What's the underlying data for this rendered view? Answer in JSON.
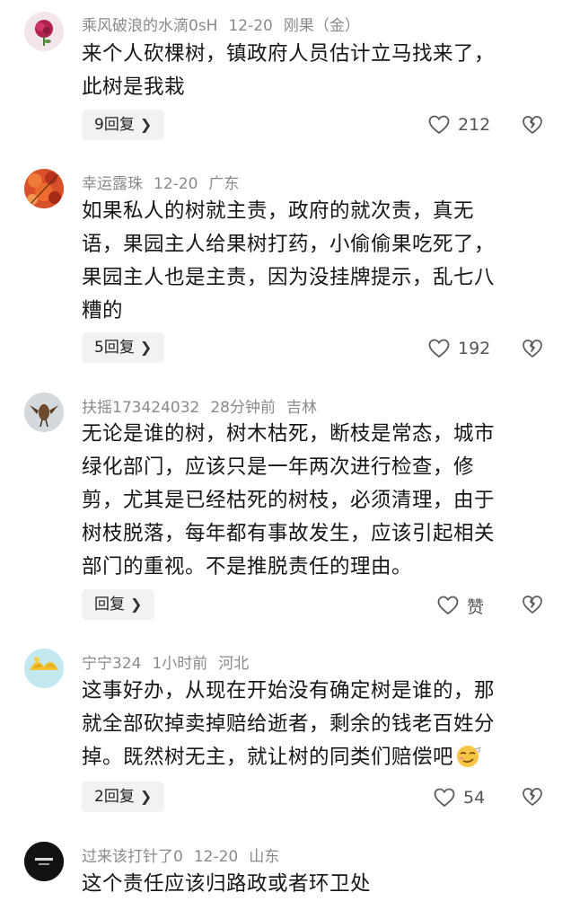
{
  "comments": [
    {
      "username": "乘风破浪的水滴0sH",
      "time": "12-20",
      "location": "刚果（金）",
      "lines": [
        "来个人砍棵树，镇政府人员估计立马找来了，",
        "此树是我栽"
      ],
      "reply_label": "9回复",
      "like_count": "212"
    },
    {
      "username": "幸运露珠",
      "time": "12-20",
      "location": "广东",
      "lines": [
        "如果私人的树就主责，政府的就次责，真无",
        "语，果园主人给果树打药，小偷偷果吃死了，",
        "果园主人也是主责，因为没挂牌提示，乱七八",
        "糟的"
      ],
      "reply_label": "5回复",
      "like_count": "192"
    },
    {
      "username": "扶摇173424032",
      "time": "28分钟前",
      "location": "吉林",
      "lines": [
        "无论是谁的树，树木枯死，断枝是常态，城市",
        "绿化部门，应该只是一年两次进行检查，修",
        "剪，尤其是已经枯死的树枝，必须清理，由于",
        "树枝脱落，每年都有事故发生，应该引起相关",
        "部门的重视。不是推脱责任的理由。"
      ],
      "reply_label": "回复",
      "like_count": "赞"
    },
    {
      "username": "宁宁324",
      "time": "1小时前",
      "location": "河北",
      "lines": [
        "这事好办，从现在开始没有确定树是谁的，那",
        "就全部砍掉卖掉赔给逝者，剩余的钱老百姓分",
        "掉。既然树无主，就让树的同类们赔偿吧"
      ],
      "reply_label": "2回复",
      "like_count": "54"
    },
    {
      "username": "过来该打针了0",
      "time": "12-20",
      "location": "山东",
      "lines": [
        "这个责任应该归路政或者环卫处"
      ]
    }
  ],
  "icons": {
    "like": "heart-outline-icon",
    "dislike": "broken-heart-icon",
    "chevron": "chevron-right-icon",
    "emoji": "smirk-emoji-icon"
  },
  "colors": {
    "meta_text": "#8a8a8a",
    "body_text": "#161616",
    "reply_bg": "#f2f2f2"
  }
}
